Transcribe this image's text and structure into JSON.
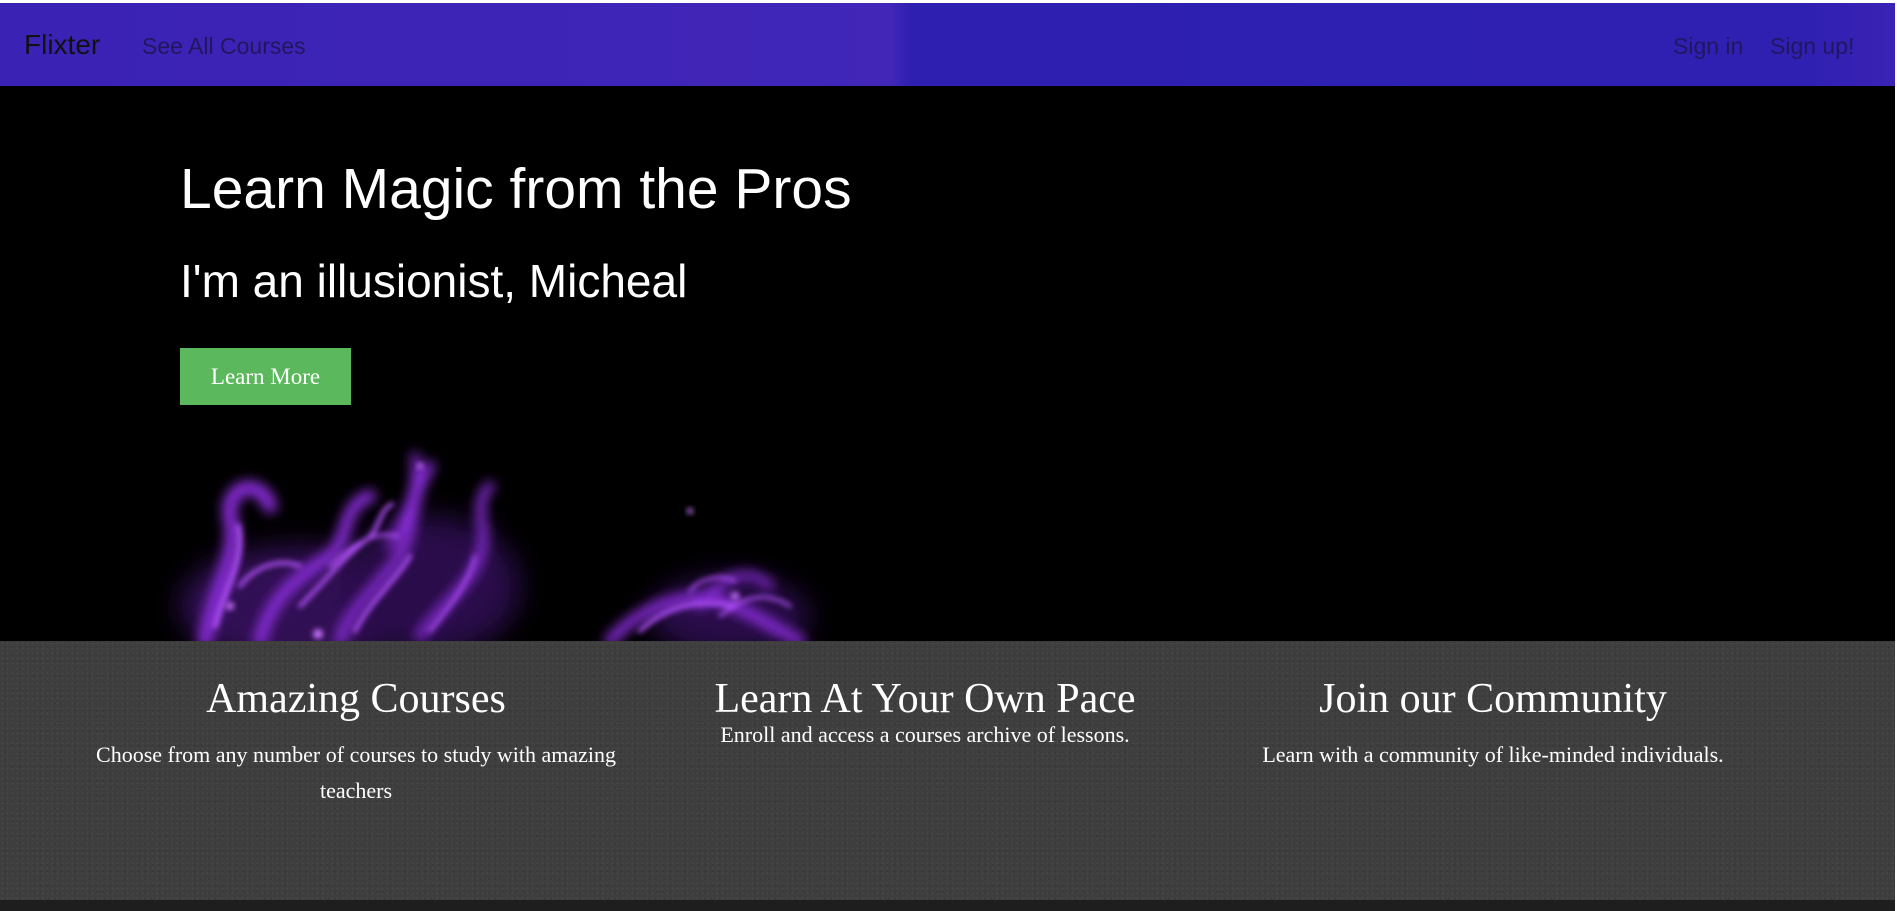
{
  "nav": {
    "brand": "Flixter",
    "courses_link": "See All Courses",
    "signin_link": "Sign in",
    "signup_link": "Sign up!"
  },
  "hero": {
    "title": "Learn Magic from the Pros",
    "subtitle": "I'm an illusionist, Micheal",
    "button": "Learn More"
  },
  "features": [
    {
      "title": "Amazing Courses",
      "text": "Choose from any number of courses to study with amazing teachers"
    },
    {
      "title": "Learn At Your Own Pace",
      "text": "Enroll and access a courses archive of lessons."
    },
    {
      "title": "Join our Community",
      "text": "Learn with a community of like-minded individuals."
    }
  ],
  "colors": {
    "navbar": "#3a22b4",
    "hero_background": "#000000",
    "button_green": "#5cb85c",
    "features_background": "#3e3e3e",
    "smoke_purple": "#8a2be2"
  }
}
